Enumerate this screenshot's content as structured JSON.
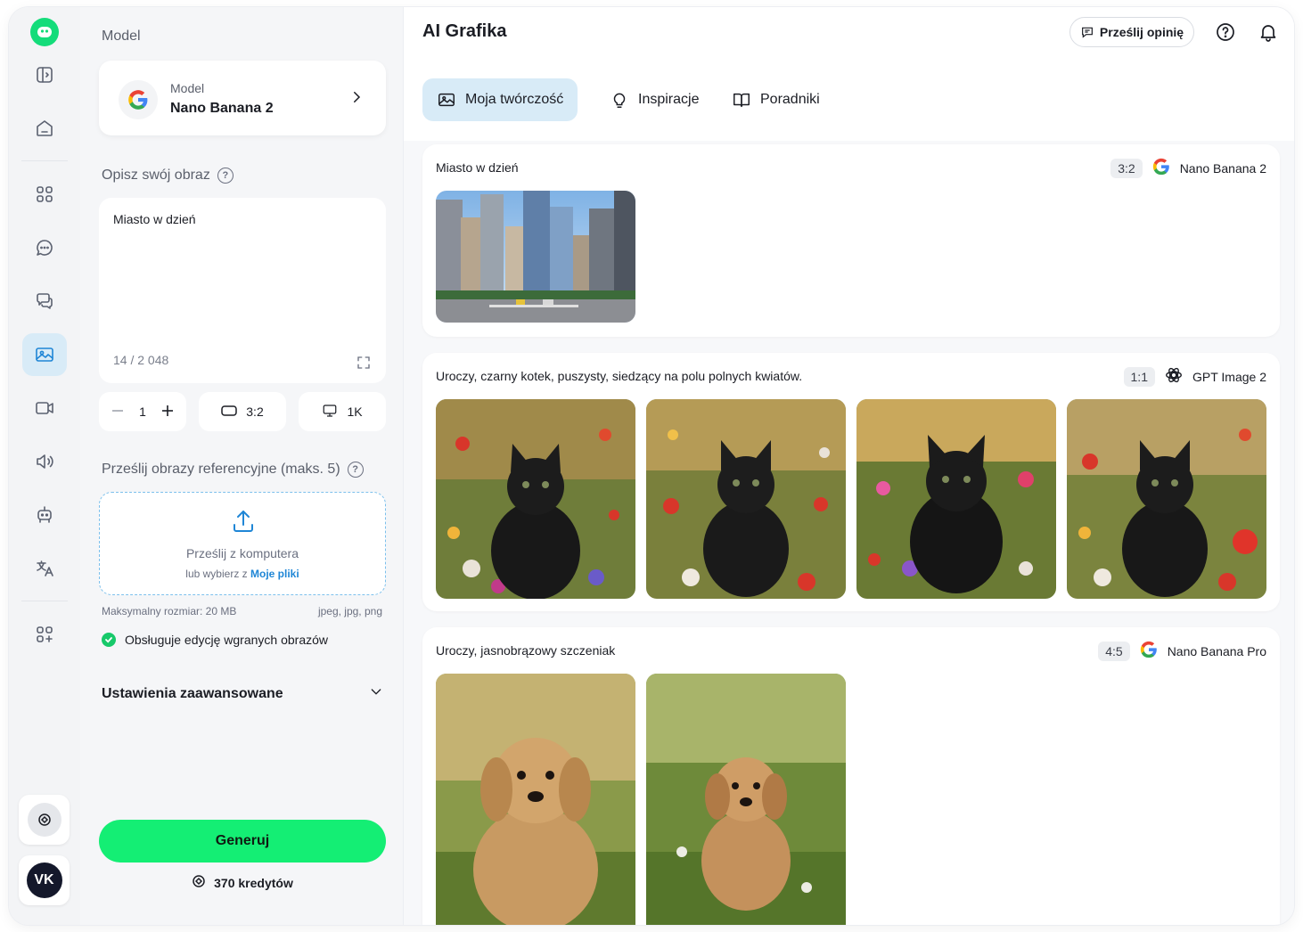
{
  "rail": {
    "items": [
      "logo",
      "sidebar-toggle",
      "home",
      "apps",
      "chat",
      "chats",
      "image",
      "video",
      "audio",
      "robot",
      "translate",
      "add-apps"
    ],
    "avatar_initials": "VK"
  },
  "panel": {
    "model_label": "Model",
    "model_card_sub": "Model",
    "model_name": "Nano Banana 2",
    "describe_label": "Opisz swój obraz",
    "prompt_value": "Miasto w dzień",
    "char_counter": "14 / 2 048",
    "quantity": "1",
    "aspect_ratio": "3:2",
    "resolution": "1K",
    "upload_label": "Prześlij obrazy referencyjne (maks. 5)",
    "upload_title": "Prześlij z komputera",
    "upload_sub_prefix": "lub wybierz z ",
    "upload_sub_link": "Moje pliki",
    "max_size": "Maksymalny rozmiar: 20 MB",
    "formats": "jpeg, jpg, png",
    "edit_support": "Obsługuje edycję wgranych obrazów",
    "advanced": "Ustawienia zaawansowane",
    "generate": "Generuj",
    "credits": "370 kredytów"
  },
  "header": {
    "title": "AI Grafika",
    "feedback": "Prześlij opinię"
  },
  "tabs": [
    {
      "label": "Moja twórczość",
      "active": true
    },
    {
      "label": "Inspiracje",
      "active": false
    },
    {
      "label": "Poradniki",
      "active": false
    }
  ],
  "groups": [
    {
      "prompt": "Miasto w dzień",
      "ratio": "3:2",
      "model": "Nano Banana 2",
      "images": 1
    },
    {
      "prompt": "Uroczy, czarny kotek, puszysty, siedzący na polu polnych kwiatów.",
      "ratio": "1:1",
      "model": "GPT Image 2",
      "images": 4
    },
    {
      "prompt": "Uroczy, jasnobrązowy szczeniak",
      "ratio": "4:5",
      "model": "Nano Banana Pro",
      "images": 2
    }
  ],
  "colors": {
    "accent_green": "#14ee74",
    "active_blue_bg": "#d8ebf7",
    "active_blue": "#1f86d6"
  }
}
